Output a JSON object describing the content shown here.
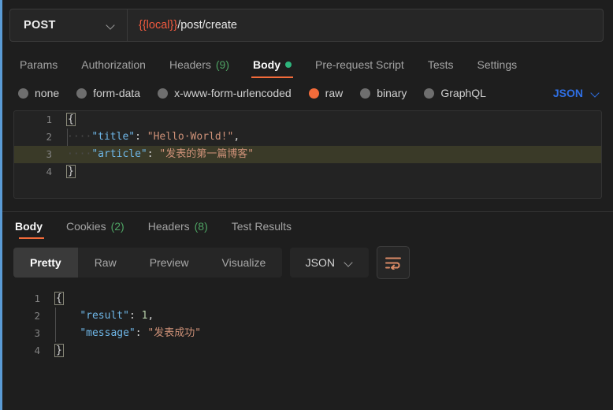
{
  "request": {
    "method": "POST",
    "method_caret_icon": "chevron-down-icon",
    "url_variable": "{{local}}",
    "url_path": "/post/create",
    "tabs": [
      {
        "label": "Params",
        "count": "",
        "active": false,
        "dot": false
      },
      {
        "label": "Authorization",
        "count": "",
        "active": false,
        "dot": false
      },
      {
        "label": "Headers",
        "count": "(9)",
        "active": false,
        "dot": false
      },
      {
        "label": "Body",
        "count": "",
        "active": true,
        "dot": true
      },
      {
        "label": "Pre-request Script",
        "count": "",
        "active": false,
        "dot": false
      },
      {
        "label": "Tests",
        "count": "",
        "active": false,
        "dot": false
      },
      {
        "label": "Settings",
        "count": "",
        "active": false,
        "dot": false
      }
    ],
    "body_types": [
      {
        "label": "none",
        "selected": false
      },
      {
        "label": "form-data",
        "selected": false
      },
      {
        "label": "x-www-form-urlencoded",
        "selected": false
      },
      {
        "label": "raw",
        "selected": true
      },
      {
        "label": "binary",
        "selected": false
      },
      {
        "label": "GraphQL",
        "selected": false
      }
    ],
    "format_label": "JSON",
    "format_caret_icon": "chevron-down-icon",
    "editor": {
      "lines": [
        {
          "num": "1",
          "highlight": false,
          "brace": "{",
          "indent": "",
          "key": "",
          "sep": "",
          "value": "",
          "value_type": "",
          "trail": ""
        },
        {
          "num": "2",
          "highlight": false,
          "brace": "",
          "indent": "····",
          "key": "\"title\"",
          "sep": ": ",
          "value": "\"Hello·World!\"",
          "value_type": "string",
          "trail": ","
        },
        {
          "num": "3",
          "highlight": true,
          "brace": "",
          "indent": "····",
          "key": "\"article\"",
          "sep": ": ",
          "value": "\"发表的第一篇博客\"",
          "value_type": "string",
          "trail": ""
        },
        {
          "num": "4",
          "highlight": false,
          "brace": "}",
          "indent": "",
          "key": "",
          "sep": "",
          "value": "",
          "value_type": "",
          "trail": ""
        }
      ]
    }
  },
  "response": {
    "tabs": [
      {
        "label": "Body",
        "count": "",
        "active": true
      },
      {
        "label": "Cookies",
        "count": "(2)",
        "active": false
      },
      {
        "label": "Headers",
        "count": "(8)",
        "active": false
      },
      {
        "label": "Test Results",
        "count": "",
        "active": false
      }
    ],
    "view_modes": [
      {
        "label": "Pretty",
        "active": true
      },
      {
        "label": "Raw",
        "active": false
      },
      {
        "label": "Preview",
        "active": false
      },
      {
        "label": "Visualize",
        "active": false
      }
    ],
    "format_label": "JSON",
    "format_caret_icon": "chevron-down-icon",
    "wrap_icon": "word-wrap-icon",
    "editor": {
      "lines": [
        {
          "num": "1",
          "highlight": false,
          "brace": "{",
          "indent": "",
          "key": "",
          "sep": "",
          "value": "",
          "value_type": "",
          "trail": ""
        },
        {
          "num": "2",
          "highlight": false,
          "brace": "",
          "indent": "    ",
          "key": "\"result\"",
          "sep": ": ",
          "value": "1",
          "value_type": "number",
          "trail": ","
        },
        {
          "num": "3",
          "highlight": false,
          "brace": "",
          "indent": "    ",
          "key": "\"message\"",
          "sep": ": ",
          "value": "\"发表成功\"",
          "value_type": "string",
          "trail": ""
        },
        {
          "num": "4",
          "highlight": false,
          "brace": "}",
          "indent": "",
          "key": "",
          "sep": "",
          "value": "",
          "value_type": "",
          "trail": ""
        }
      ]
    }
  },
  "colors": {
    "accent_orange": "#f26b3a",
    "variable_red": "#f15a3f",
    "json_blue": "#2f6fe4",
    "key_blue": "#6fb7e8",
    "string_salmon": "#ce9178",
    "number_green": "#b5cea8",
    "badge_green": "#4ea363",
    "dot_green": "#2eb67d",
    "background": "#1e1e1e"
  }
}
